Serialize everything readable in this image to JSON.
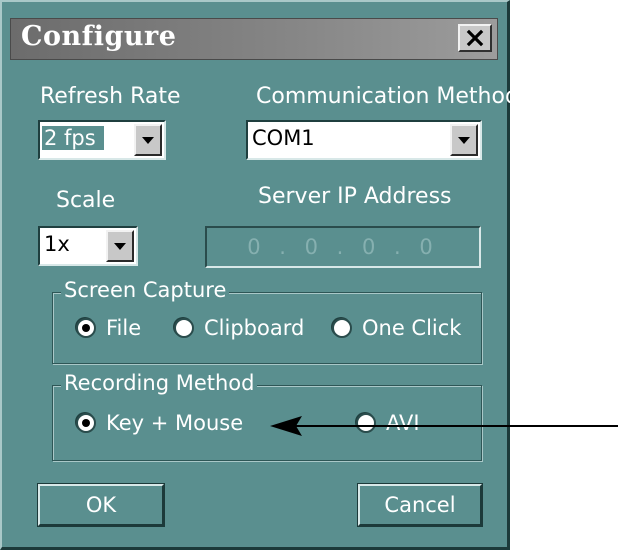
{
  "window": {
    "title": "Configure",
    "close_glyph": "close-icon"
  },
  "refresh_rate": {
    "label": "Refresh Rate",
    "value": "2 fps"
  },
  "communication": {
    "label": "Communication Method",
    "value": "COM1"
  },
  "scale": {
    "label": "Scale",
    "value": "1x"
  },
  "server_ip": {
    "label": "Server IP Address",
    "value": "0 . 0 . 0 . 0"
  },
  "screen_capture": {
    "title": "Screen Capture",
    "options": [
      {
        "label": "File",
        "checked": true
      },
      {
        "label": "Clipboard",
        "checked": false
      },
      {
        "label": "One Click",
        "checked": false
      }
    ]
  },
  "recording_method": {
    "title": "Recording Method",
    "options": [
      {
        "label": "Key + Mouse",
        "checked": true
      },
      {
        "label": "AVI",
        "checked": false
      }
    ]
  },
  "buttons": {
    "ok": "OK",
    "cancel": "Cancel"
  },
  "colors": {
    "dialog_bg": "#5a8f8f",
    "title_bar": "#878787",
    "text": "#ffffff"
  }
}
